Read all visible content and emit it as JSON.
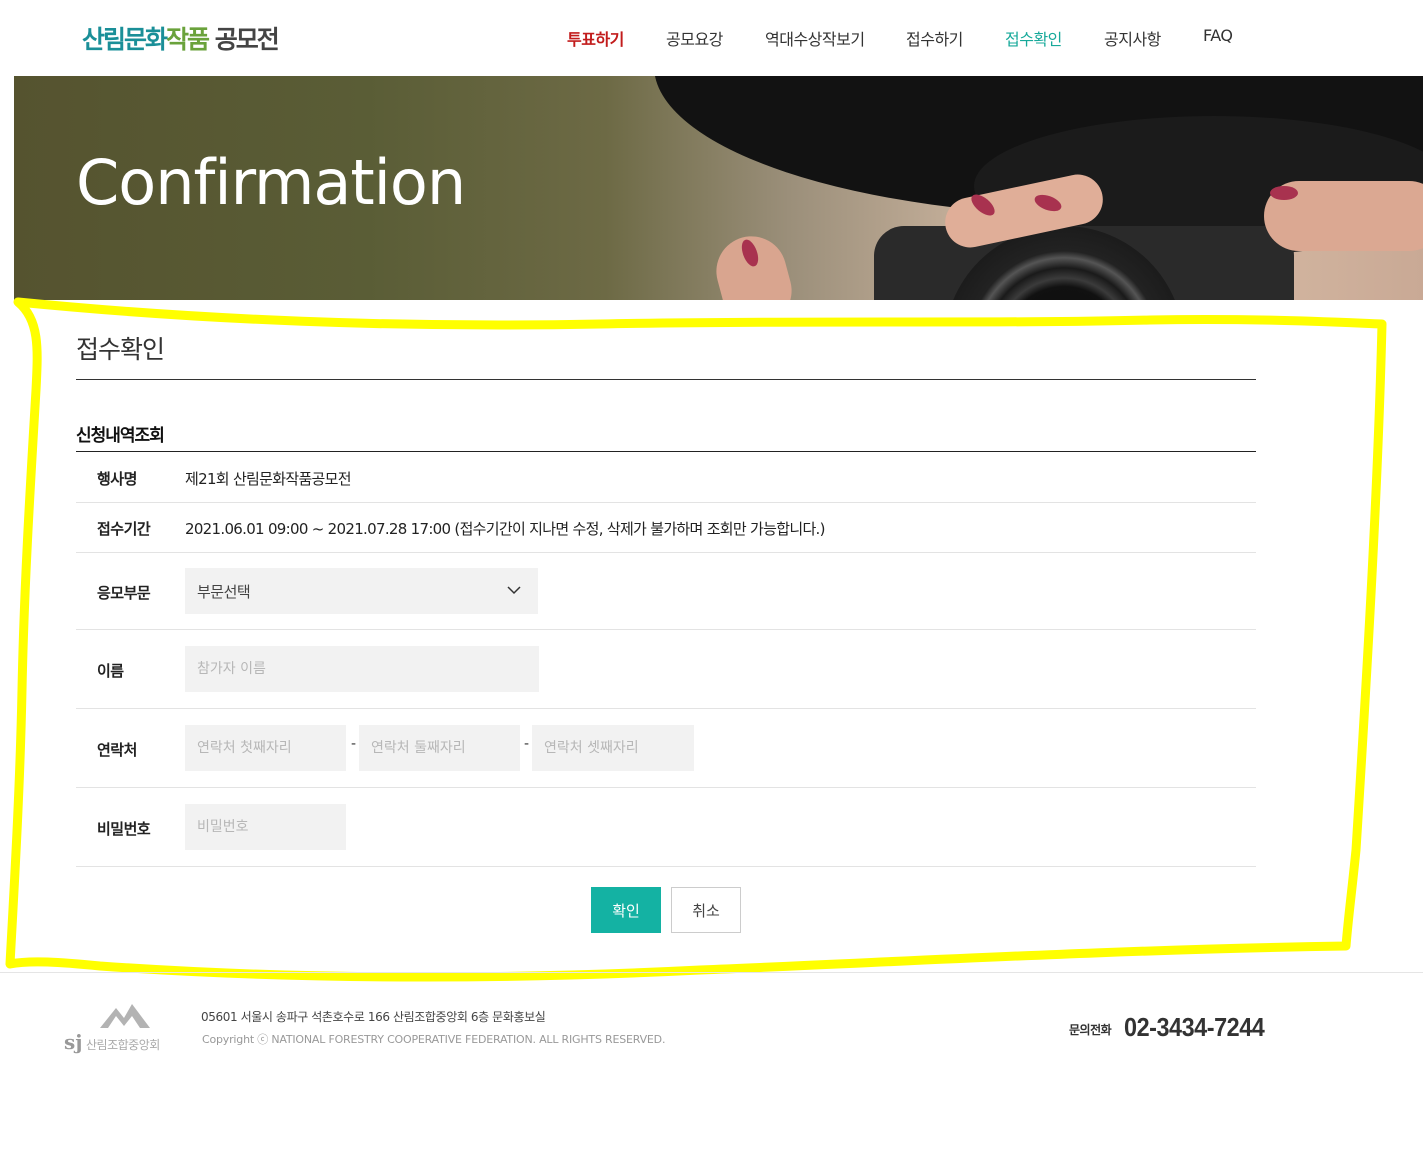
{
  "header": {
    "logo": {
      "part1": "산림문화",
      "part2": "작품",
      "part3": " 공모전"
    },
    "nav": [
      {
        "label": "투표하기"
      },
      {
        "label": "공모요강"
      },
      {
        "label": "역대수상작보기"
      },
      {
        "label": "접수하기"
      },
      {
        "label": "접수확인"
      },
      {
        "label": "공지사항"
      },
      {
        "label": "FAQ"
      }
    ]
  },
  "banner": {
    "title": "Confirmation"
  },
  "page": {
    "title": "접수확인",
    "section_title": "신청내역조회",
    "event_label": "행사명",
    "event_value": "제21회 산림문화작품공모전",
    "period_label": "접수기간",
    "period_value": "2021.06.01 09:00 ~ 2021.07.28 17:00 (접수기간이 지나면 수정, 삭제가 불가하며 조회만 가능합니다.)",
    "category_label": "응모부문",
    "category_selected": "부문선택",
    "name_label": "이름",
    "name_placeholder": "참가자 이름",
    "contact_label": "연락처",
    "contact_placeholder_1": "연락처 첫째자리",
    "contact_placeholder_2": "연락처 둘째자리",
    "contact_placeholder_3": "연락처 셋째자리",
    "contact_separator": "-",
    "password_label": "비밀번호",
    "password_placeholder": "비밀번호",
    "confirm_button": "확인",
    "cancel_button": "취소"
  },
  "footer": {
    "logo_mark": "sj",
    "logo_org": "산림조합중앙회",
    "address": "05601 서울시 송파구 석촌호수로 166 산림조합중앙회 6층 문화홍보실",
    "copyright": "Copyright ⓒ NATIONAL FORESTRY COOPERATIVE FEDERATION. ALL RIGHTS RESERVED.",
    "phone_label": "문의전화",
    "phone": "02-3434-7244"
  },
  "colors": {
    "accent": "#14b2a3",
    "vote_nav": "#c21c1c",
    "annotation": "#ffff00"
  },
  "icons": {
    "select_arrow": "chevron-down-icon",
    "footer_logo": "mountain-logo-icon"
  }
}
